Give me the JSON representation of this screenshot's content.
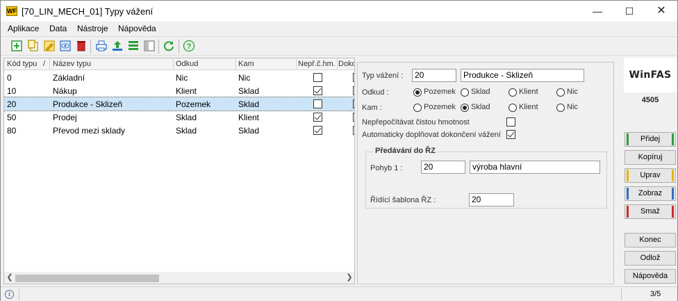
{
  "window": {
    "title": "[70_LIN_MECH_01] Typy vážení",
    "logo_text": "WF"
  },
  "menu": [
    "Aplikace",
    "Data",
    "Nástroje",
    "Nápověda"
  ],
  "toolbar": {
    "icons": [
      "add-icon",
      "copy-icon",
      "edit-icon",
      "view-icon",
      "delete-icon",
      "print-icon",
      "export-icon",
      "list-icon",
      "columns-icon",
      "refresh-icon",
      "help-icon"
    ],
    "colors": {
      "green": "#2e9e3a",
      "yellow": "#e8b400",
      "blue": "#2f6fc2",
      "red": "#d02c2c"
    }
  },
  "grid": {
    "columns": [
      "Kód typu",
      "Název typu",
      "Odkud",
      "Kam",
      "Nepř.č.hm.",
      "Dokon"
    ],
    "sort_marker": "/",
    "rows": [
      {
        "code": "0",
        "name": "Základní",
        "from": "Nic",
        "to": "Nic",
        "nepr": false,
        "selected": false
      },
      {
        "code": "10",
        "name": "Nákup",
        "from": "Klient",
        "to": "Sklad",
        "nepr": true,
        "selected": false
      },
      {
        "code": "20",
        "name": "Produkce - Sklizeň",
        "from": "Pozemek",
        "to": "Sklad",
        "nepr": false,
        "selected": true
      },
      {
        "code": "50",
        "name": "Prodej",
        "from": "Sklad",
        "to": "Klient",
        "nepr": true,
        "selected": false
      },
      {
        "code": "80",
        "name": "Převod mezi sklady",
        "from": "Sklad",
        "to": "Sklad",
        "nepr": true,
        "selected": false
      }
    ]
  },
  "detail": {
    "typ_label": "Typ vážení :",
    "typ_code": "20",
    "typ_name": "Produkce - Sklizeň",
    "odkud_label": "Odkud :",
    "kam_label": "Kam :",
    "options": [
      "Pozemek",
      "Sklad",
      "Klient",
      "Nic"
    ],
    "odkud_selected": "Pozemek",
    "kam_selected": "Sklad",
    "nepr_label": "Nepřepočítávat čistou hmotnost",
    "nepr_checked": false,
    "auto_label": "Automaticky doplňovat dokončení vážení",
    "auto_checked": true,
    "group_title": "Předávání do ŘZ",
    "pohyb_label": "Pohyb 1 :",
    "pohyb_code": "20",
    "pohyb_name": "výroba hlavní",
    "sablona_label": "Řídící šablona ŘZ :",
    "sablona_value": "20"
  },
  "brand": {
    "name": "WinFAS",
    "number": "4505"
  },
  "buttons": {
    "pridej": "Přidej",
    "kopiruj": "Kopíruj",
    "uprav": "Uprav",
    "zobraz": "Zobraz",
    "smaz": "Smaž",
    "konec": "Konec",
    "odloz": "Odlož",
    "napoveda": "Nápověda"
  },
  "status": {
    "record": "3/5"
  }
}
